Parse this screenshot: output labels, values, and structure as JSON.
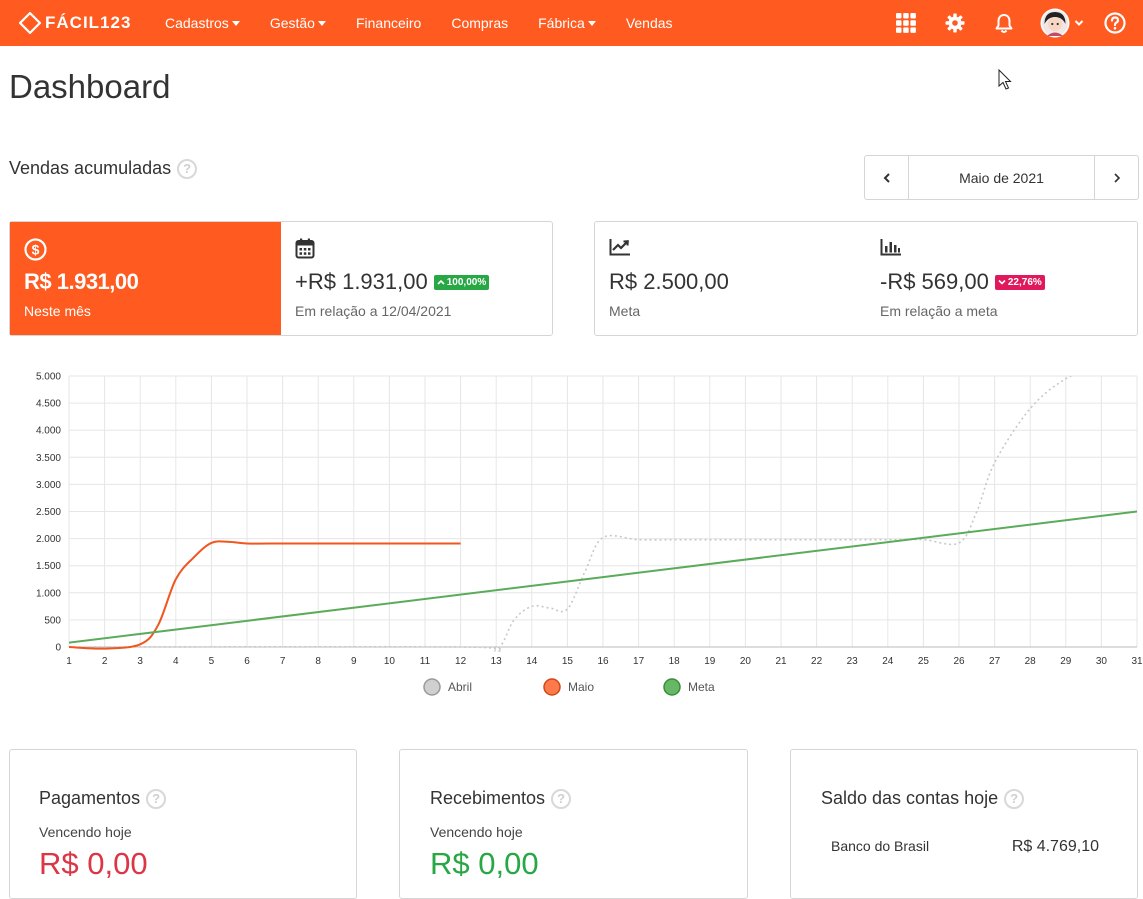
{
  "brand": {
    "name": "FÁCIL123"
  },
  "nav": [
    {
      "label": "Cadastros",
      "caret": true
    },
    {
      "label": "Gestão",
      "caret": true
    },
    {
      "label": "Financeiro",
      "caret": false
    },
    {
      "label": "Compras",
      "caret": false
    },
    {
      "label": "Fábrica",
      "caret": true
    },
    {
      "label": "Vendas",
      "caret": false
    }
  ],
  "header_icons": [
    "apps-grid-icon",
    "gear-icon",
    "bell-icon",
    "user-avatar",
    "help-icon"
  ],
  "page": {
    "title": "Dashboard"
  },
  "section": {
    "title": "Vendas acumuladas",
    "help": "?"
  },
  "month_picker": {
    "prev": "‹",
    "label": "Maio de 2021",
    "next": "›"
  },
  "stats_left": {
    "month": {
      "value": "R$ 1.931,00",
      "label": "Neste mês"
    },
    "compare": {
      "value": "+R$ 1.931,00",
      "badge": "100,00%",
      "label": "Em relação a 12/04/2021"
    }
  },
  "stats_right": {
    "goal": {
      "value": "R$ 2.500,00",
      "label": "Meta"
    },
    "diff": {
      "value": "-R$ 569,00",
      "badge": "22,76%",
      "label": "Em relação a meta"
    }
  },
  "colors": {
    "accent": "#ff5a1f",
    "abril": "#c8c8c8",
    "maio": "#f0561d",
    "meta": "#5aab5a"
  },
  "chart_data": {
    "type": "line",
    "x": [
      1,
      2,
      3,
      4,
      5,
      6,
      7,
      8,
      9,
      10,
      11,
      12,
      13,
      14,
      15,
      16,
      17,
      18,
      19,
      20,
      21,
      22,
      23,
      24,
      25,
      26,
      27,
      28,
      29,
      30,
      31
    ],
    "x_ticks": [
      "1",
      "2",
      "3",
      "4",
      "5",
      "6",
      "7",
      "8",
      "9",
      "10",
      "11",
      "12",
      "13",
      "14",
      "15",
      "16",
      "17",
      "18",
      "19",
      "20",
      "21",
      "22",
      "23",
      "24",
      "25",
      "26",
      "27",
      "28",
      "29",
      "30",
      "31"
    ],
    "y_ticks": [
      "0",
      "500",
      "1.000",
      "1.500",
      "2.000",
      "2.500",
      "3.000",
      "3.500",
      "4.000",
      "4.500",
      "5.000"
    ],
    "ylim": [
      0,
      5000
    ],
    "grid": true,
    "legend_position": "bottom",
    "series": [
      {
        "name": "Abril",
        "style": "dotted",
        "x": [
          1,
          12,
          13,
          13.5,
          14,
          14.5,
          15,
          15.5,
          16,
          17,
          18,
          19,
          20,
          21,
          22,
          23,
          24,
          25,
          26,
          26.5,
          27,
          28,
          29,
          30
        ],
        "values": [
          0,
          0,
          -50,
          500,
          750,
          720,
          700,
          1400,
          2020,
          1980,
          1980,
          1980,
          1980,
          1980,
          1980,
          1980,
          1980,
          1980,
          1920,
          2500,
          3400,
          4400,
          4950,
          5200
        ]
      },
      {
        "name": "Maio",
        "style": "solid",
        "x": [
          1,
          2,
          3,
          3.5,
          4,
          4.5,
          5,
          5.5,
          6,
          7,
          8,
          9,
          10,
          11,
          12
        ],
        "values": [
          0,
          -30,
          50,
          400,
          1250,
          1650,
          1920,
          1940,
          1910,
          1910,
          1910,
          1910,
          1910,
          1910,
          1910
        ]
      },
      {
        "name": "Meta",
        "style": "solid",
        "x": [
          1,
          31
        ],
        "values": [
          80,
          2500
        ]
      }
    ]
  },
  "bottom_cards": {
    "payments": {
      "title": "Pagamentos",
      "sub": "Vencendo hoje",
      "value": "R$ 0,00"
    },
    "receipts": {
      "title": "Recebimentos",
      "sub": "Vencendo hoje",
      "value": "R$ 0,00"
    },
    "balance": {
      "title": "Saldo das contas hoje",
      "bank": "Banco do Brasil",
      "value": "R$ 4.769,10"
    }
  }
}
